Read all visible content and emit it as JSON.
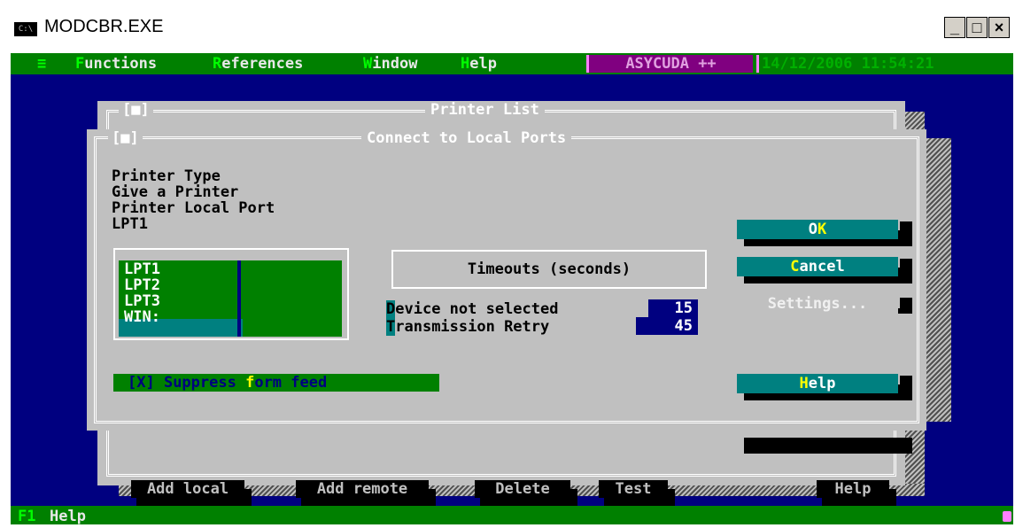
{
  "window": {
    "title": "MODCBR.EXE",
    "icon": "C:\\",
    "min_label": "_",
    "max_label": "□",
    "close_label": "×"
  },
  "menu": {
    "system": "≡",
    "items": [
      {
        "hot": "F",
        "rest": "unctions"
      },
      {
        "hot": "R",
        "rest": "eferences"
      },
      {
        "hot": "W",
        "rest": "indow"
      },
      {
        "hot": "H",
        "rest": "elp"
      }
    ],
    "app_name": "ASYCUDA ++",
    "datetime": "14/12/2006 11:54:21"
  },
  "printer_list": {
    "title": "Printer List",
    "close": "[■]",
    "buttons": [
      {
        "label": "Add local"
      },
      {
        "label": "Add remote"
      },
      {
        "label": "Delete"
      },
      {
        "label": "Test"
      },
      {
        "label": "Help"
      }
    ]
  },
  "connect_dialog": {
    "title": "Connect to Local Ports",
    "close": "[■]",
    "info_lines": [
      "Printer Type",
      "Give a Printer",
      "Printer Local Port",
      "LPT1"
    ],
    "ports": [
      "LPT1",
      "LPT2",
      "LPT3",
      "WIN:"
    ],
    "selected_port_index": 3,
    "timeouts_title": "Timeouts (seconds)",
    "device_not_selected": {
      "hot": "D",
      "rest": "evice not selected",
      "value": "15"
    },
    "transmission_retry": {
      "hot": "T",
      "rest": "ransmission Retry",
      "value": "45"
    },
    "suppress": {
      "check": "[X]",
      "pre": " Suppress ",
      "hot": "f",
      "post": "orm feed"
    },
    "ok": {
      "pre": "O",
      "hot": "K",
      "post": ""
    },
    "cancel": {
      "pre": "",
      "hot": "C",
      "post": "ancel"
    },
    "settings": "Settings...",
    "help": {
      "pre": "",
      "hot": "H",
      "post": "elp"
    }
  },
  "status": {
    "key": "F1",
    "label": "Help"
  },
  "colors": {
    "console_bg": "#000080",
    "menu_bg": "#008000",
    "dialog_bg": "#c0c0c0",
    "button_bg": "#008080",
    "hotkey": "#ffff00"
  }
}
